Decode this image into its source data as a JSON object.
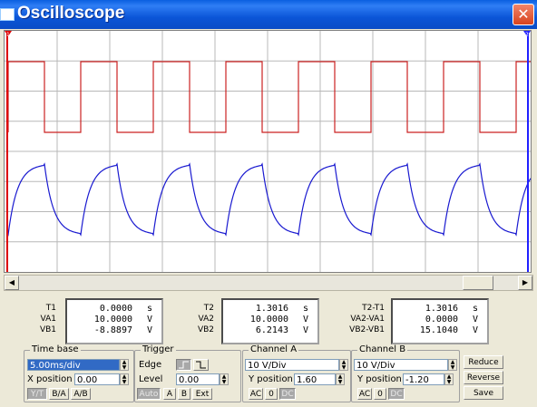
{
  "window": {
    "title": "Oscilloscope",
    "close_glyph": "✕"
  },
  "screen": {
    "cursor1_label": "1",
    "cursor2_label": "2",
    "colors": {
      "channel_a": "#cc2222",
      "channel_b": "#1a1ad0",
      "grid": "#b8b8b8",
      "cursor1": "#dd0000",
      "cursor2": "#2020ff"
    }
  },
  "readout1": {
    "rows": [
      {
        "label": "T1",
        "value": "0.0000",
        "unit": "s"
      },
      {
        "label": "VA1",
        "value": "10.0000",
        "unit": "V"
      },
      {
        "label": "VB1",
        "value": "-8.8897",
        "unit": "V"
      }
    ]
  },
  "readout2": {
    "rows": [
      {
        "label": "T2",
        "value": "1.3016",
        "unit": "s"
      },
      {
        "label": "VA2",
        "value": "10.0000",
        "unit": "V"
      },
      {
        "label": "VB2",
        "value": "6.2143",
        "unit": "V"
      }
    ]
  },
  "readout3": {
    "rows": [
      {
        "label": "T2-T1",
        "value": "1.3016",
        "unit": "s"
      },
      {
        "label": "VA2-VA1",
        "value": "0.0000",
        "unit": "V"
      },
      {
        "label": "VB2-VB1",
        "value": "15.1040",
        "unit": "V"
      }
    ]
  },
  "timebase": {
    "title": "Time base",
    "scale": "5.00ms/div",
    "xpos_label": "X position",
    "xpos": "0.00",
    "modes": [
      "Y/T",
      "B/A",
      "A/B"
    ]
  },
  "trigger": {
    "title": "Trigger",
    "edge_label": "Edge",
    "level_label": "Level",
    "level": "0.00",
    "sources": [
      "Auto",
      "A",
      "B",
      "Ext"
    ]
  },
  "channel_a": {
    "title": "Channel A",
    "scale": "10 V/Div",
    "ypos_label": "Y position",
    "ypos": "1.60",
    "coupling": [
      "AC",
      "0",
      "DC"
    ]
  },
  "channel_b": {
    "title": "Channel B",
    "scale": "10 V/Div",
    "ypos_label": "Y position",
    "ypos": "-1.20",
    "coupling": [
      "AC",
      "0",
      "DC"
    ]
  },
  "actions": {
    "reduce": "Reduce",
    "reverse": "Reverse",
    "save": "Save"
  }
}
